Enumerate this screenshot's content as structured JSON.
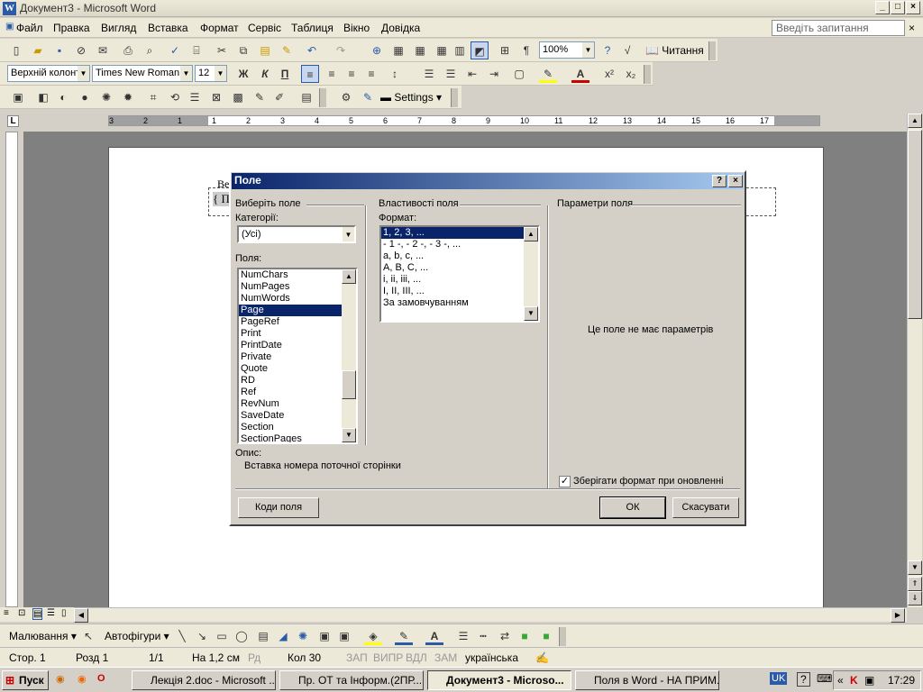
{
  "window": {
    "title": "Документ3 - Microsoft Word",
    "icon": "word-icon"
  },
  "menu": [
    "Файл",
    "Правка",
    "Вигляд",
    "Вставка",
    "Формат",
    "Сервіс",
    "Таблиця",
    "Вікно",
    "Довідка"
  ],
  "ask_box": {
    "placeholder": "Введіть запитання"
  },
  "toolbar1": {
    "zoom": "100%",
    "reading_label": "Читання"
  },
  "toolbar2": {
    "style": "Верхній колонт",
    "font": "Times New Roman",
    "size": "12",
    "bold": "Ж",
    "italic": "К",
    "underline": "П"
  },
  "toolbar3": {
    "settings_label": "Settings"
  },
  "ruler": {
    "labels": [
      "3",
      "2",
      "1",
      "1",
      "2",
      "3",
      "4",
      "5",
      "6",
      "7",
      "8",
      "9",
      "10",
      "11",
      "12",
      "13",
      "14",
      "15",
      "16",
      "17"
    ]
  },
  "document": {
    "partial_text": "Ве",
    "field_code_text": "{ П"
  },
  "dialog": {
    "title": "Поле",
    "help": "?",
    "close": "×",
    "select_field_heading": "Виберіть поле",
    "categories_label": "Категорії:",
    "categories_value": "(Усі)",
    "fields_label": "Поля:",
    "fields": [
      "NumChars",
      "NumPages",
      "NumWords",
      "Page",
      "PageRef",
      "Print",
      "PrintDate",
      "Private",
      "Quote",
      "RD",
      "Ref",
      "RevNum",
      "SaveDate",
      "Section",
      "SectionPages"
    ],
    "selected_field": "Page",
    "properties_heading": "Властивості поля",
    "format_label": "Формат:",
    "formats": [
      "1, 2, 3, ...",
      "- 1 -, - 2 -, - 3 -, ...",
      "a, b, c, ...",
      "A, B, C, ...",
      "i, ii, iii, ...",
      "I, II, III, ...",
      "За замовчуванням"
    ],
    "selected_format": "1, 2, 3, ...",
    "parameters_heading": "Параметри поля",
    "no_params_text": "Це поле не має параметрів",
    "description_label": "Опис:",
    "description_text": "Вставка номера поточної сторінки",
    "preserve_format_label": "Зберігати формат при оновленні",
    "preserve_format_checked": true,
    "field_codes_button": "Коди поля",
    "ok_button": "ОК",
    "cancel_button": "Скасувати"
  },
  "drawbar": {
    "drawing_label": "Малювання",
    "autoshapes_label": "Автофігури"
  },
  "status": {
    "page": "Стор.  1",
    "section": "Розд  1",
    "pages": "1/1",
    "at": "На  1,2 см",
    "line": "Рд",
    "col": "Кол  30",
    "rec": "ЗАП",
    "trk": "ВИПР",
    "ext": "ВДЛ",
    "ovr": "ЗАМ",
    "language": "українська"
  },
  "taskbar": {
    "start": "Пуск",
    "tasks": [
      "Лекція 2.doc - Microsoft ...",
      "Пр. ОТ та Інформ.(2ПР...",
      "Документ3 - Microso...",
      "Поля в Word - НА ПРИМ..."
    ],
    "active_task": 2,
    "lang": "UK",
    "clock": "17:29"
  }
}
